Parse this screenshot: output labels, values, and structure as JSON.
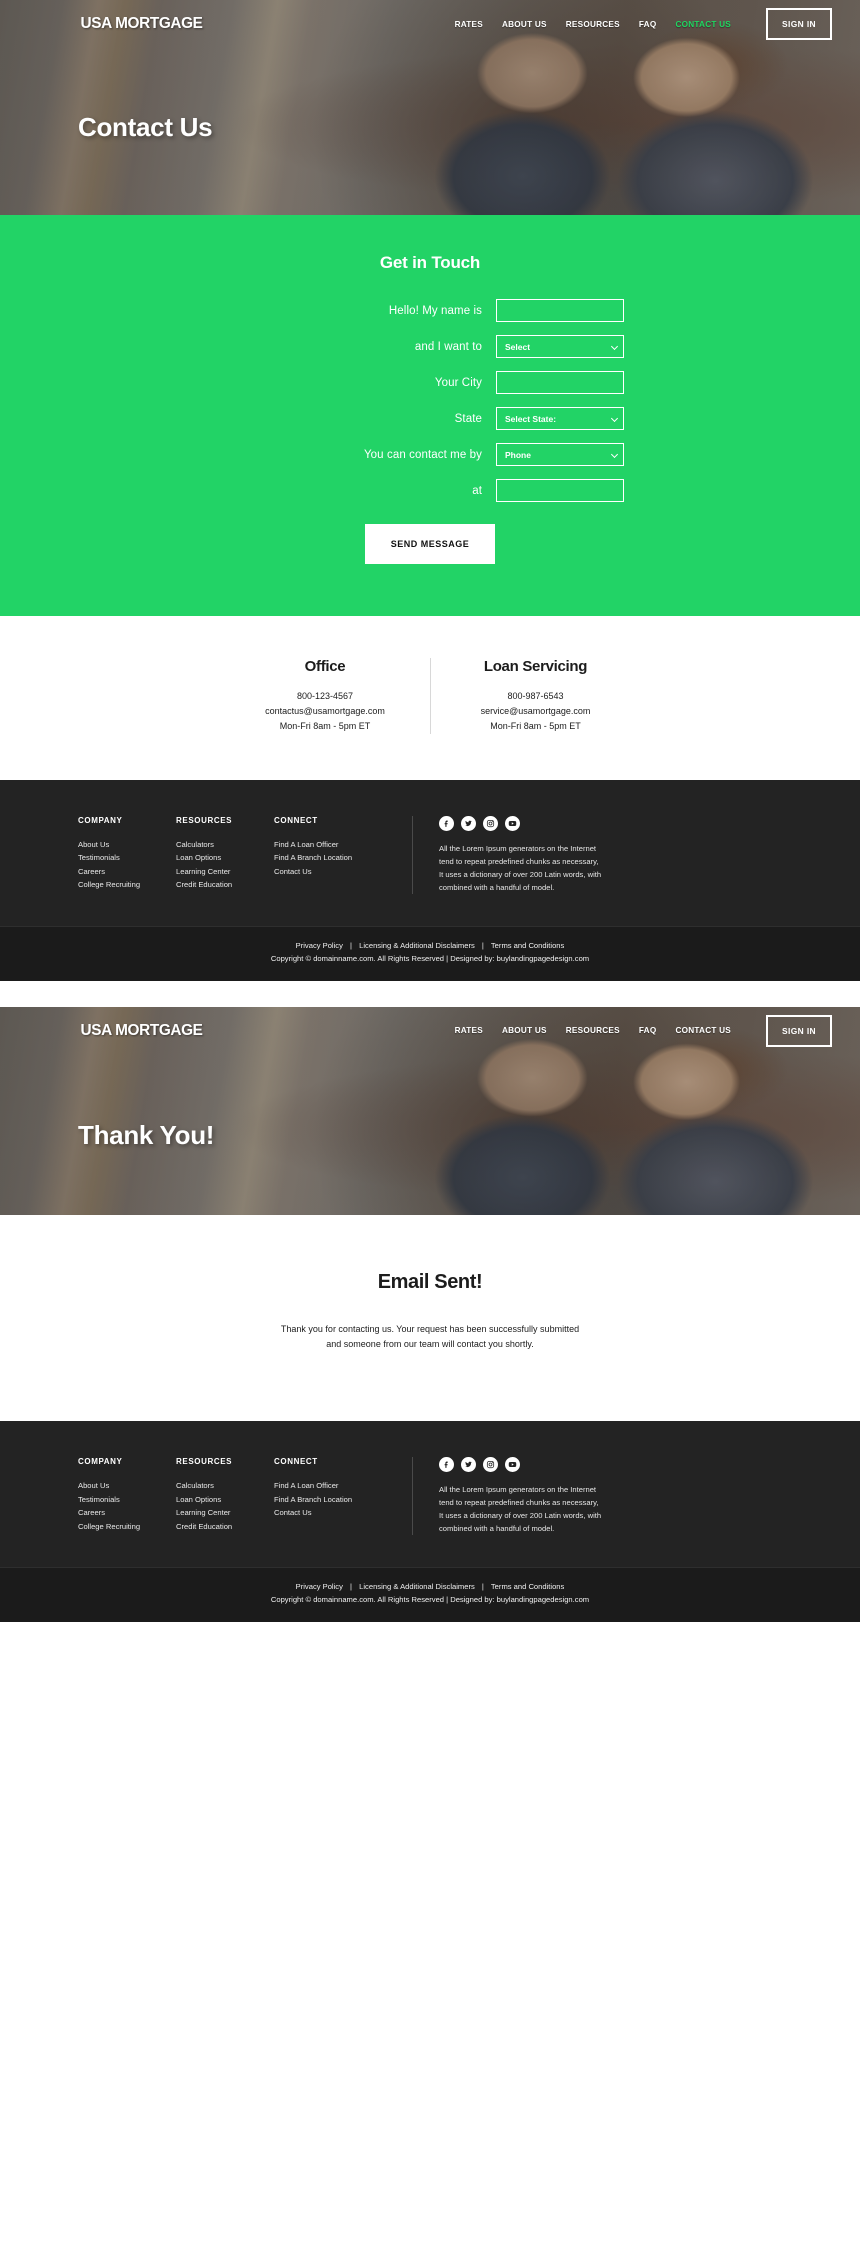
{
  "brand": "USA MORTGAGE",
  "nav": {
    "links": [
      {
        "label": "RATES",
        "active": false
      },
      {
        "label": "ABOUT US",
        "active": false
      },
      {
        "label": "RESOURCES",
        "active": false
      },
      {
        "label": "FAQ",
        "active": false
      },
      {
        "label": "CONTACT US",
        "active": true
      }
    ],
    "signin_label": "SIGN IN",
    "accent_color": "#1fd760"
  },
  "nav2": {
    "links": [
      {
        "label": "RATES"
      },
      {
        "label": "ABOUT US"
      },
      {
        "label": "RESOURCES"
      },
      {
        "label": "FAQ"
      },
      {
        "label": "CONTACT US"
      }
    ],
    "signin_label": "SIGN IN"
  },
  "hero": {
    "title": "Contact Us"
  },
  "hero2": {
    "title": "Thank You!"
  },
  "form": {
    "section_bg": "#22d366",
    "title": "Get in Touch",
    "rows": [
      {
        "label": "Hello! My name is",
        "type": "text",
        "value": ""
      },
      {
        "label": "and I want to",
        "type": "select",
        "value": "Select"
      },
      {
        "label": "Your City",
        "type": "text",
        "value": ""
      },
      {
        "label": "State",
        "type": "select",
        "value": "Select State:"
      },
      {
        "label": "You can contact me by",
        "type": "select",
        "value": "Phone"
      },
      {
        "label": "at",
        "type": "text",
        "value": ""
      }
    ],
    "submit_label": "SEND MESSAGE"
  },
  "contact": {
    "office": {
      "heading": "Office",
      "phone": "800-123-4567",
      "email": "contactus@usamortgage.com",
      "hours": "Mon-Fri 8am - 5pm ET"
    },
    "servicing": {
      "heading": "Loan Servicing",
      "phone": "800-987-6543",
      "email": "service@usamortgage.com",
      "hours": "Mon-Fri 8am - 5pm ET"
    }
  },
  "footer": {
    "company": {
      "heading": "COMPANY",
      "links": [
        "About Us",
        "Testimonials",
        "Careers",
        "College Recruiting"
      ]
    },
    "resources": {
      "heading": "RESOURCES",
      "links": [
        "Calculators",
        "Loan Options",
        "Learning Center",
        "Credit Education"
      ]
    },
    "connect": {
      "heading": "CONNECT",
      "links": [
        "Find A Loan Officer",
        "Find A Branch Location",
        "Contact Us"
      ]
    },
    "social": [
      "facebook-icon",
      "twitter-icon",
      "instagram-icon",
      "youtube-icon"
    ],
    "about": "All the Lorem Ipsum generators on the Internet tend to repeat predefined chunks as necessary, It uses a dictionary of over 200 Latin words, with combined with a handful of model.",
    "legal_links": [
      "Privacy Policy",
      "Licensing & Additional Disclaimers",
      "Terms and Conditions"
    ],
    "legal_sep": "|",
    "copyright": "Copyright © domainname.com. All Rights Reserved | Designed by: buylandingpagedesign.com"
  },
  "thanks": {
    "heading": "Email Sent!",
    "line1": "Thank you for contacting us. Your request has been successfully submitted",
    "line2": "and someone from our team will contact you shortly."
  }
}
